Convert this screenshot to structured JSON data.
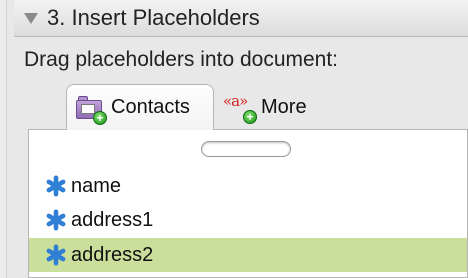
{
  "section": {
    "title": "3. Insert Placeholders"
  },
  "instructions": "Drag placeholders into document:",
  "tabs": [
    {
      "label": "Contacts",
      "icon": "contacts-folder-icon"
    },
    {
      "label": "More",
      "icon": "quote-placeholder-icon"
    }
  ],
  "search": {
    "value": ""
  },
  "placeholders": [
    {
      "label": "name",
      "icon": "asterisk-icon"
    },
    {
      "label": "address1",
      "icon": "asterisk-icon"
    },
    {
      "label": "address2",
      "icon": "asterisk-icon",
      "selected": true
    }
  ],
  "colors": {
    "selection": "#cadf9c",
    "asterisk": "#2f7fd6",
    "quote": "#d42020"
  }
}
